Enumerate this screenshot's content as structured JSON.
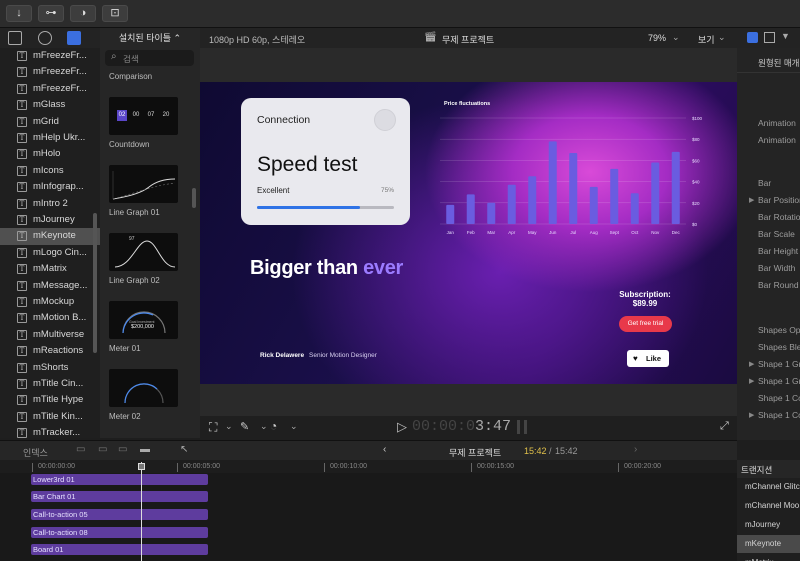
{
  "toolbar": {
    "btn1": "↓",
    "btn2": "⊶",
    "btn3": "◑",
    "btn4": "⊡"
  },
  "browser": {
    "dropdown": "설치된 타이틀 ⌃",
    "search_placeholder": "검색",
    "titles": [
      "mFreezeFr...",
      "mFreezeFr...",
      "mFreezeFr...",
      "mGlass",
      "mGrid",
      "mHelp Ukr...",
      "mHolo",
      "mIcons",
      "mInfograp...",
      "mIntro 2",
      "mJourney",
      "mKeynote",
      "mLogo Cin...",
      "mMatrix",
      "mMessage...",
      "mMockup",
      "mMotion B...",
      "mMultiverse",
      "mReactions",
      "mShorts",
      "mTitle Cin...",
      "mTitle Hype",
      "mTitle Kin...",
      "mTracker..."
    ],
    "selected_index": 11,
    "thumbs": [
      "Comparison",
      "Countdown",
      "Line Graph 01",
      "Line Graph 02",
      "Meter 01",
      "Meter 02"
    ],
    "countdown_digits": [
      "02",
      "00",
      "07",
      "20"
    ],
    "meter_label": "Goal Investment",
    "meter_value": "$200,000",
    "lg2_value": "97"
  },
  "viewer": {
    "format": "1080p HD 60p, 스테레오",
    "project": "무제 프로젝트",
    "zoom": "79%",
    "view": "보기",
    "timecode": "00:00:03:47",
    "timecode_dim": "00:00:0",
    "timecode_bright": "3:47"
  },
  "canvas": {
    "card_title": "Connection",
    "card_heading": "Speed test",
    "card_label": "Excellent",
    "card_percent": "75%",
    "card_progress": 0.75,
    "headline_plain": "Bigger than ",
    "headline_accent": "ever",
    "author": "Rick Delawere",
    "role": "Senior Motion Designer",
    "subscription_label": "Subscription:",
    "subscription_price": "$89.99",
    "cta": "Get free trial",
    "like": "Like",
    "chart_title": "Price fluctuations"
  },
  "chart_data": {
    "type": "bar",
    "title": "Price fluctuations",
    "categories": [
      "Jan",
      "Feb",
      "Mar",
      "Apr",
      "May",
      "Jun",
      "Jul",
      "Aug",
      "Sept",
      "Oct",
      "Nov",
      "Dec"
    ],
    "values": [
      18,
      28,
      20,
      37,
      45,
      78,
      67,
      35,
      52,
      29,
      58,
      68
    ],
    "ylim": [
      0,
      100
    ],
    "yticks": [
      "$100",
      "$80",
      "$60",
      "$40",
      "$20",
      "$0"
    ]
  },
  "inspector": {
    "subheader": "원형된 매개변",
    "props": [
      "Animation",
      "Animation",
      "Bar",
      "Bar Position",
      "Bar Rotation",
      "Bar Scale",
      "Bar Height",
      "Bar Width",
      "Bar Round",
      "Shapes Op",
      "Shapes Ble",
      "Shape 1 Gr",
      "Shape 1 Gr",
      "Shape 1 Co",
      "Shape 1 Co"
    ]
  },
  "timeline": {
    "index": "인덱스",
    "project": "무제 프로젝트",
    "time_current": "15:42",
    "time_total": "15:42",
    "ruler": [
      "00:00:00:00",
      "00:00:05:00",
      "00:00:10:00",
      "00:00:15:00",
      "00:00:20:00"
    ],
    "clips": [
      "Lower3rd 01",
      "Bar Chart 01",
      "Call-to-action 05",
      "Call-to-action 08",
      "Board 01"
    ]
  },
  "transitions": {
    "header": "트랜지션",
    "items": [
      "mChannel Glitc",
      "mChannel Moo",
      "mJourney",
      "mKeynote",
      "mMatrix"
    ],
    "selected_index": 3
  },
  "colors": {
    "accent": "#7c5cff",
    "clip": "#5e3c9e",
    "cta": "#e8394a",
    "bar": "#6a5ce0"
  }
}
